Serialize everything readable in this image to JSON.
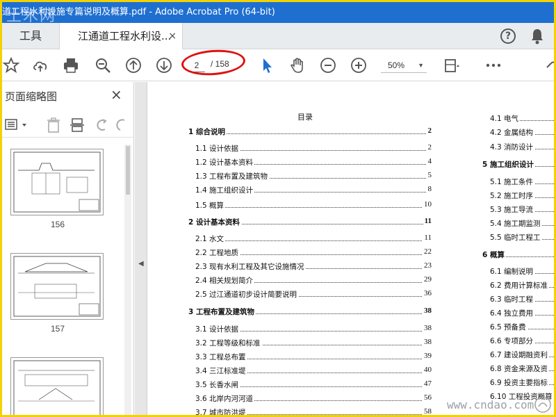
{
  "window": {
    "title": "道工程水利设施专篇说明及概算.pdf - Adobe Acrobat Pro (64-bit)",
    "watermark_top": "土木网"
  },
  "tabs": {
    "tools_label": "工具",
    "doc_label": "江通道工程水利设...",
    "close_symbol": "×",
    "help_symbol": "?"
  },
  "toolbar": {
    "page_current": "2",
    "page_total": "/ 158",
    "zoom": "50%"
  },
  "panel": {
    "title": "页面缩略图",
    "close_symbol": "×",
    "thumbnails": [
      {
        "label": "156"
      },
      {
        "label": "157"
      },
      {
        "label": ""
      }
    ]
  },
  "toc": {
    "title": "目录",
    "left_entries": [
      {
        "label": "1  综合说明",
        "page": "2",
        "level": 1
      },
      {
        "label": "1.1  设计依据",
        "page": "2",
        "level": 2
      },
      {
        "label": "1.2  设计基本资料",
        "page": "4",
        "level": 2
      },
      {
        "label": "1.3  工程布置及建筑物",
        "page": "5",
        "level": 2
      },
      {
        "label": "1.4  施工组织设计",
        "page": "8",
        "level": 2
      },
      {
        "label": "1.5  概算",
        "page": "10",
        "level": 2
      },
      {
        "label": "2  设计基本资料",
        "page": "11",
        "level": 1
      },
      {
        "label": "2.1  水文",
        "page": "11",
        "level": 2
      },
      {
        "label": "2.2  工程地质",
        "page": "22",
        "level": 2
      },
      {
        "label": "2.3  现有水利工程及其它设施情况",
        "page": "23",
        "level": 2
      },
      {
        "label": "2.4  相关规划简介",
        "page": "29",
        "level": 2
      },
      {
        "label": "2.5  过江通道初步设计简要说明",
        "page": "36",
        "level": 2
      },
      {
        "label": "3  工程布置及建筑物",
        "page": "38",
        "level": 1
      },
      {
        "label": "3.1  设计依据",
        "page": "38",
        "level": 2
      },
      {
        "label": "3.2  工程等级和标准",
        "page": "38",
        "level": 2
      },
      {
        "label": "3.3  工程总布置",
        "page": "39",
        "level": 2
      },
      {
        "label": "3.4  三江标准堤",
        "page": "40",
        "level": 2
      },
      {
        "label": "3.5  长香水闸",
        "page": "47",
        "level": 2
      },
      {
        "label": "3.6  北岸内河河道",
        "page": "56",
        "level": 2
      },
      {
        "label": "3.7  城市防洪堤",
        "page": "58",
        "level": 2
      }
    ],
    "right_entries": [
      {
        "label": "4.1  电气",
        "level": 2
      },
      {
        "label": "4.2  金属结构",
        "level": 2
      },
      {
        "label": "4.3  消防设计",
        "level": 2
      },
      {
        "label": "5  施工组织设计",
        "level": 1
      },
      {
        "label": "5.1  施工条件",
        "level": 2
      },
      {
        "label": "5.2  施工时序",
        "level": 2
      },
      {
        "label": "5.3  施工导流",
        "level": 2
      },
      {
        "label": "5.4  施工期监测",
        "level": 2
      },
      {
        "label": "5.5  临时工程工",
        "level": 2
      },
      {
        "label": "6  概算",
        "level": 1
      },
      {
        "label": "6.1  编制说明",
        "level": 2
      },
      {
        "label": "6.2  费用计算标准",
        "level": 2
      },
      {
        "label": "6.3  临时工程",
        "level": 2
      },
      {
        "label": "6.4  独立费用",
        "level": 2
      },
      {
        "label": "6.5  预备费",
        "level": 2
      },
      {
        "label": "6.6  专项部分",
        "level": 2
      },
      {
        "label": "6.7  建设期融资利",
        "level": 2
      },
      {
        "label": "6.8  资金来源及资",
        "level": 2
      },
      {
        "label": "6.9  投资主要指标",
        "level": 2
      },
      {
        "label": "6.10  工程投资概算",
        "level": 2
      }
    ]
  },
  "watermark_bottom": "www.cndao.com",
  "colors": {
    "titlebar": "#1f6fd0",
    "highlight": "#e01010",
    "border": "#f2d200",
    "select_tool": "#1f6fd0"
  }
}
